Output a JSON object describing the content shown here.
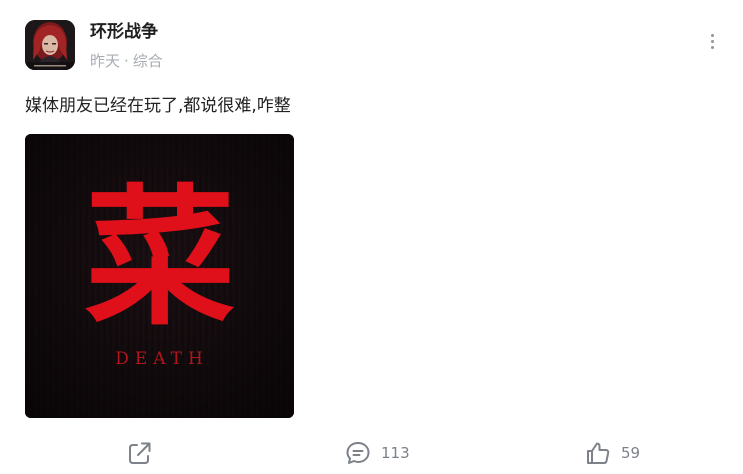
{
  "post": {
    "author": "环形战争",
    "time": "昨天",
    "separator": "·",
    "category": "综合",
    "text": "媒体朋友已经在玩了,都说很难,咋整",
    "image": {
      "main_character": "菜",
      "caption": "DEATH",
      "accent_color": "#e0101a",
      "background_color": "#120b0d"
    }
  },
  "actions": {
    "share_icon": "share-icon",
    "comment_icon": "comment-icon",
    "comment_count": "113",
    "like_icon": "thumbs-up-icon",
    "like_count": "59"
  },
  "colors": {
    "text": "#222222",
    "meta": "#a8acb3",
    "icon": "#7d828a"
  }
}
